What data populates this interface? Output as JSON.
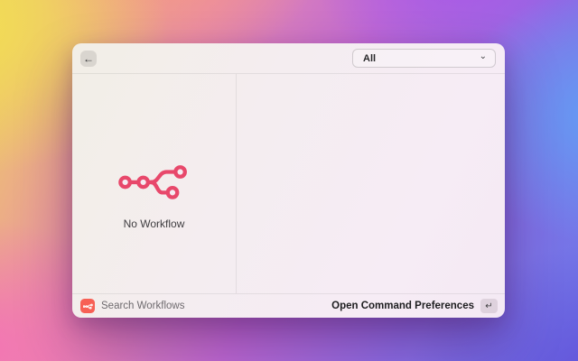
{
  "header": {
    "back_button": {
      "icon": "←"
    },
    "filter_dropdown": {
      "value": "All",
      "chevron_icon": "⌄"
    }
  },
  "left_panel": {
    "empty_state_label": "No Workflow"
  },
  "footer": {
    "command_label": "Search Workflows",
    "action_label": "Open Command Preferences",
    "enter_key_icon": "↵"
  },
  "colors": {
    "workflow_icon": "#e8486b",
    "command_icon_bg": "#f76055",
    "window_bg": "#f4edf0",
    "background_accents": [
      "#f2dc55",
      "#f46eb9",
      "#a858e8",
      "#61a0f5",
      "#624cd7"
    ]
  }
}
